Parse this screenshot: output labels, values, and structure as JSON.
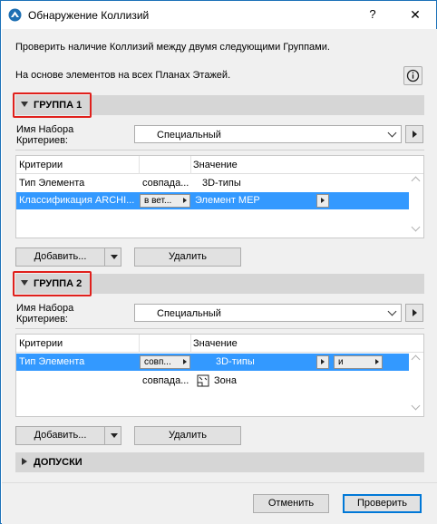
{
  "window": {
    "title": "Обнаружение Коллизий",
    "help_label": "?",
    "close_label": "✕"
  },
  "description": {
    "line1": "Проверить наличие Коллизий между двумя следующими Группами.",
    "line2": "На основе элементов на всех Планах Этажей."
  },
  "group1": {
    "header": "ГРУППА 1",
    "criteria_set_label_1": "Имя Набора",
    "criteria_set_label_2": "Критериев:",
    "criteria_set_value": "Специальный",
    "table": {
      "columns": [
        "Критерии",
        "Значение"
      ],
      "rows": [
        {
          "criterion": "Тип Элемента",
          "operator": "совпада...",
          "value": "3D-типы",
          "selected": false
        },
        {
          "criterion": "Классификация ARCHI...",
          "operator": "в вет...",
          "value": "Элемент MEP",
          "selected": true
        }
      ]
    },
    "add_button": "Добавить...",
    "delete_button": "Удалить"
  },
  "group2": {
    "header": "ГРУППА 2",
    "criteria_set_label_1": "Имя Набора",
    "criteria_set_label_2": "Критериев:",
    "criteria_set_value": "Специальный",
    "table": {
      "columns": [
        "Критерии",
        "Значение"
      ],
      "rows": [
        {
          "criterion": "Тип Элемента",
          "operator": "совп...",
          "value": "3D-типы",
          "logic": "и",
          "selected": true
        },
        {
          "criterion": "",
          "operator": "совпада...",
          "value": "Зона",
          "selected": false
        }
      ]
    },
    "add_button": "Добавить...",
    "delete_button": "Удалить"
  },
  "tolerances": {
    "header": "ДОПУСКИ"
  },
  "footer": {
    "cancel_button": "Отменить",
    "check_button": "Проверить"
  },
  "colors": {
    "selection": "#3399ff",
    "highlight_box": "#e0201c",
    "primary_border": "#0078d7"
  }
}
